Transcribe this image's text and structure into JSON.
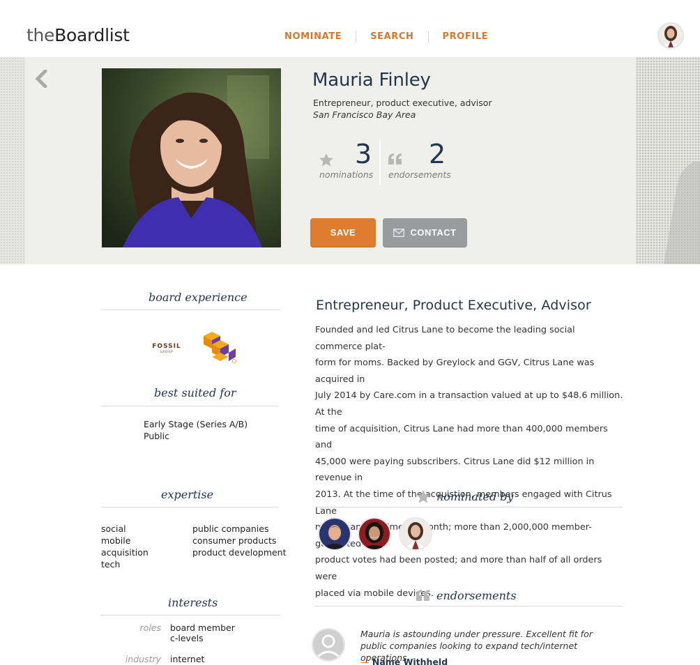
{
  "header": {
    "logo_prefix": "the",
    "logo_main": "Boardlist",
    "nav": [
      "NOMINATE",
      "SEARCH",
      "PROFILE"
    ]
  },
  "profile": {
    "name": "Mauria Finley",
    "headline": "Entrepreneur, product executive, advisor",
    "location": "San Francisco Bay Area",
    "nominations_count": "3",
    "nominations_label": "nominations",
    "endorsements_count": "2",
    "endorsements_label": "endorsements",
    "save_label": "SAVE",
    "contact_label": "CONTACT"
  },
  "board_experience": {
    "title": "board experience",
    "logos": [
      "FOSSIL",
      "GROUP"
    ]
  },
  "best_suited": {
    "title": "best suited for",
    "items": [
      "Early Stage (Series A/B)",
      "Public"
    ]
  },
  "expertise": {
    "title": "expertise",
    "col1": [
      "social",
      "mobile",
      "acquisition",
      "tech"
    ],
    "col2": [
      "public companies",
      "consumer products",
      "product development"
    ]
  },
  "interests": {
    "title": "interests",
    "roles_label": "roles",
    "roles": [
      "board member",
      "c-levels"
    ],
    "industry_label": "industry",
    "industry": "internet"
  },
  "bio": {
    "title": "Entrepreneur, Product Executive, Advisor",
    "lines": [
      "Founded and led Citrus Lane to become the leading social commerce plat-",
      "form for moms. Backed by Greylock and GGV, Citrus Lane was acquired in",
      "July 2014 by Care.com in a transaction valued at up to $48.6 million. At the",
      "time of acquisition, Citrus Lane had more than 400,000 members and",
      "45,000 were paying subscribers. Citrus Lane did $12 million in revenue in",
      "2013. At the time of the acquistion, members engaged with Citrus Lane",
      "more than five times a month; more than 2,000,000 member-generated",
      "product votes had been posted; and more than half of all orders were",
      "placed via mobile devices."
    ]
  },
  "nominated_by": {
    "title": "nominated by"
  },
  "endorsements": {
    "title": "endorsements",
    "quote": "Mauria is astounding under pressure. Excellent fit for public companies looking to expand tech/internet operations.",
    "dash": "—",
    "author": "Name Withheld"
  },
  "colors": {
    "accent": "#df7b2d",
    "navy": "#243550",
    "gray_button": "#9a9b9d",
    "hero_bg": "#eff0eb"
  }
}
